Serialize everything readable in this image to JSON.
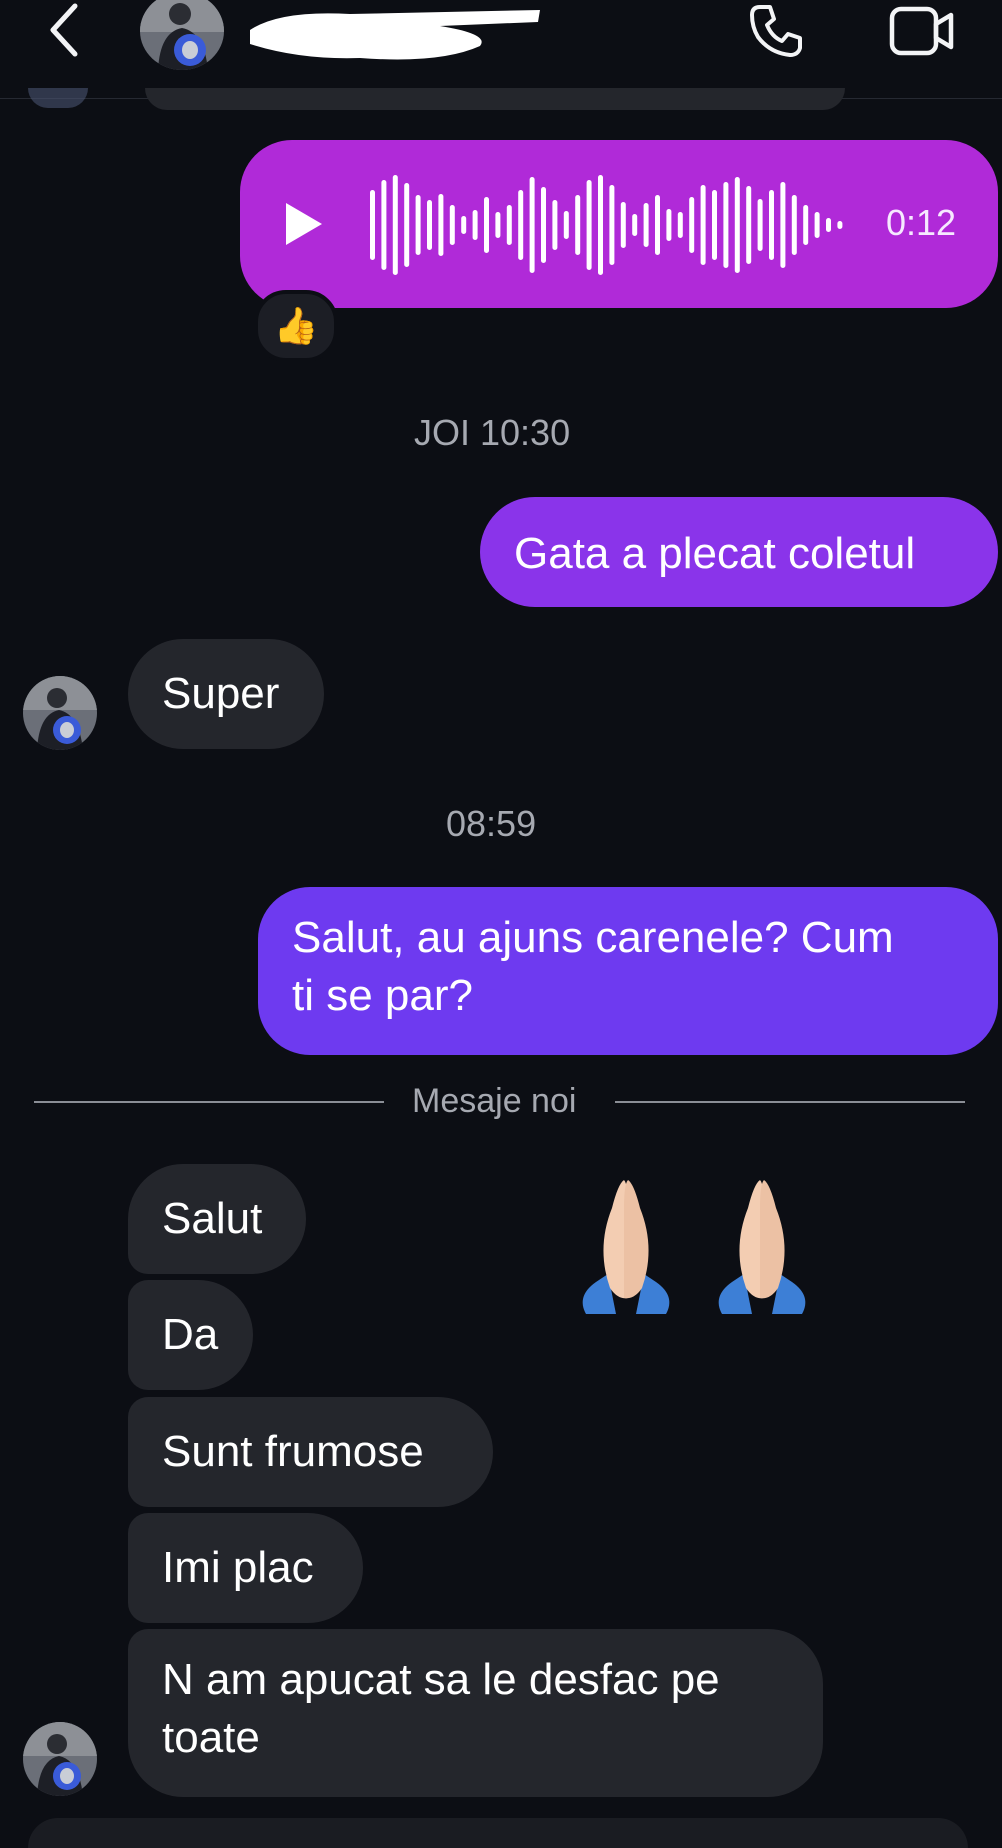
{
  "header": {
    "back_icon": "chevron-left-icon",
    "call_icon": "phone-icon",
    "video_icon": "video-camera-icon"
  },
  "voice_message": {
    "duration": "0:12",
    "reaction": "👍"
  },
  "timestamps": {
    "first": "JOI 10:30",
    "second": "08:59"
  },
  "outgoing": {
    "msg1": "Gata a plecat coletul",
    "msg2_line1": "Salut, au ajuns carenele? Cum",
    "msg2_line2": "ti se par?"
  },
  "incoming": {
    "super": "Super",
    "m1": "Salut",
    "m2": "Da",
    "m3": "Sunt frumose",
    "m4": "Imi plac",
    "m5_line1": "N am apucat sa le desfac pe",
    "m5_line2": "toate"
  },
  "divider": {
    "label": "Mesaje noi"
  },
  "colors": {
    "background": "#0c0e14",
    "voice_bubble": "#b02ad8",
    "outgoing_bubble_1": "#8a34ea",
    "outgoing_bubble_2": "#6e3af0",
    "incoming_bubble": "#24262c"
  }
}
